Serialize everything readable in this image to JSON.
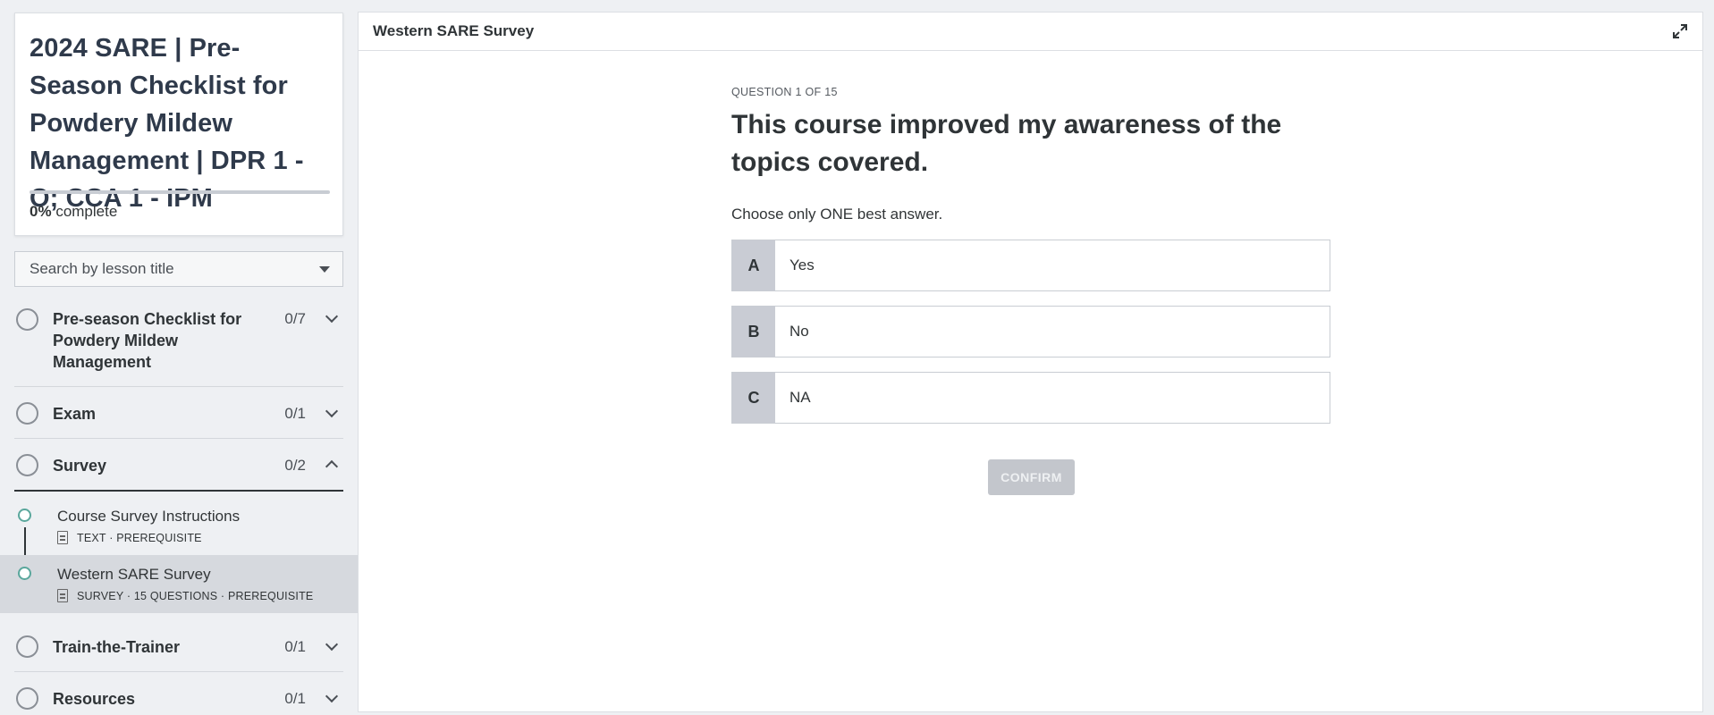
{
  "sidebar": {
    "course_title": "2024 SARE | Pre-Season Checklist for Powdery Mildew Management | DPR 1 - O; CCA 1 - IPM",
    "progress": {
      "percent_label": "0%",
      "suffix": "complete",
      "value": 0
    },
    "search": {
      "placeholder": "Search by lesson title"
    },
    "sections": [
      {
        "title": "Pre-season Checklist for Powdery Mildew Management",
        "count": "0/7",
        "expanded": false
      },
      {
        "title": "Exam",
        "count": "0/1",
        "expanded": false
      },
      {
        "title": "Survey",
        "count": "0/2",
        "expanded": true
      },
      {
        "title": "Train-the-Trainer",
        "count": "0/1",
        "expanded": false
      },
      {
        "title": "Resources",
        "count": "0/1",
        "expanded": false
      }
    ],
    "lessons": [
      {
        "title": "Course Survey Instructions",
        "meta": "TEXT · PREREQUISITE",
        "icon": "document-icon",
        "active": false
      },
      {
        "title": "Western SARE Survey",
        "meta": "SURVEY · 15 QUESTIONS · PREREQUISITE",
        "icon": "survey-icon",
        "active": true
      }
    ]
  },
  "main": {
    "title": "Western SARE Survey",
    "expand_icon": "expand-icon",
    "question": {
      "number_label": "QUESTION 1 OF 15",
      "text": "This course improved my awareness of the topics covered.",
      "instruction": "Choose only ONE best answer.",
      "options": [
        {
          "letter": "A",
          "text": "Yes"
        },
        {
          "letter": "B",
          "text": "No"
        },
        {
          "letter": "C",
          "text": "NA"
        }
      ],
      "confirm_label": "CONFIRM"
    }
  },
  "colors": {
    "accent": "#2a8a7e",
    "option_letter_bg": "#c9ccd4",
    "confirm_disabled": "#c3c6cc",
    "active_lesson_bg": "#d6d9de"
  }
}
